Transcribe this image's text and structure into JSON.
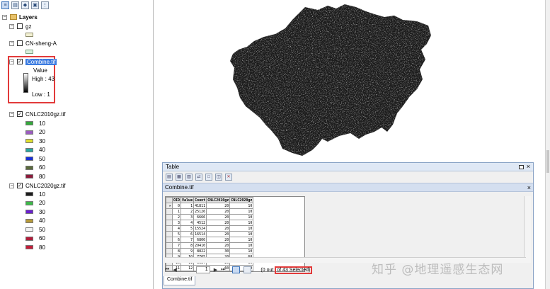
{
  "toc": {
    "root_label": "Layers",
    "layers": [
      {
        "name": "gz",
        "checked": false
      },
      {
        "name": "CN-sheng-A",
        "checked": false
      },
      {
        "name": "Combine.tif",
        "checked": true,
        "selected": true,
        "legend_title": "Value",
        "high_label": "High : 43",
        "low_label": "Low : 1"
      },
      {
        "name": "CNLC2010gz.tif",
        "checked": true,
        "classes": [
          {
            "label": "10",
            "color": "#35a83d"
          },
          {
            "label": "20",
            "color": "#9b5bbf"
          },
          {
            "label": "30",
            "color": "#e0e030"
          },
          {
            "label": "40",
            "color": "#2aa7a0"
          },
          {
            "label": "50",
            "color": "#1a2fd6"
          },
          {
            "label": "60",
            "color": "#5a6b3c"
          },
          {
            "label": "80",
            "color": "#8c1a3a"
          }
        ]
      },
      {
        "name": "CNLC2020gz.tif",
        "checked": true,
        "classes": [
          {
            "label": "10",
            "color": "#1c1c1c"
          },
          {
            "label": "20",
            "color": "#3db84a"
          },
          {
            "label": "30",
            "color": "#6a1fd0"
          },
          {
            "label": "40",
            "color": "#b79a3a"
          },
          {
            "label": "50",
            "color": "#f2f2f2"
          },
          {
            "label": "60",
            "color": "#b01c3a"
          },
          {
            "label": "80",
            "color": "#c41e3a"
          }
        ]
      }
    ]
  },
  "table_window": {
    "title": "Table",
    "close": "×",
    "tab_title": "Combine.tif",
    "columns": [
      "OID",
      "Value",
      "Count",
      "CNLC2010gz",
      "CNLC2020gz"
    ],
    "rows": [
      [
        "0",
        "1",
        "41811",
        "20",
        "10"
      ],
      [
        "1",
        "2",
        "25126",
        "20",
        "10"
      ],
      [
        "2",
        "3",
        "6666",
        "20",
        "10"
      ],
      [
        "3",
        "4",
        "4512",
        "20",
        "10"
      ],
      [
        "4",
        "5",
        "15524",
        "20",
        "10"
      ],
      [
        "5",
        "6",
        "16514",
        "20",
        "10"
      ],
      [
        "6",
        "7",
        "6800",
        "20",
        "10"
      ],
      [
        "7",
        "8",
        "29410",
        "20",
        "10"
      ],
      [
        "8",
        "9",
        "8822",
        "30",
        "10"
      ],
      [
        "9",
        "10",
        "7705",
        "20",
        "60"
      ],
      [
        "10",
        "11",
        "3187",
        "20",
        "60"
      ],
      [
        "11",
        "12",
        "575",
        "60",
        "10"
      ]
    ],
    "record_number": "1",
    "selected_status_prefix": "(0 out ",
    "selected_status_boxed": "of 43 Selected)",
    "bottom_tab": "Combine.tif"
  },
  "watermark": "知乎 @地理遥感生态网"
}
